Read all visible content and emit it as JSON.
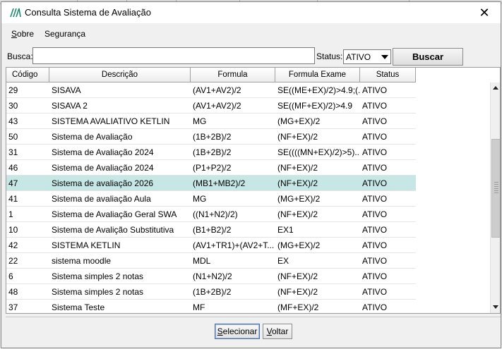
{
  "window": {
    "title": "Consulta Sistema de Avaliação"
  },
  "menu": [
    {
      "label_u": "S",
      "label_rest": "obre"
    },
    {
      "label_u": "",
      "label_rest": "Segurança"
    }
  ],
  "search": {
    "label": "Busca:",
    "value": "",
    "placeholder": ""
  },
  "status_filter": {
    "label": "Status:",
    "selected": "ATIVO"
  },
  "buscar_button": "Buscar",
  "table": {
    "columns": [
      "Código",
      "Descrição",
      "Formula",
      "Formula Exame",
      "Status"
    ],
    "selected_index": 6,
    "rows": [
      [
        "29",
        "SISAVA",
        "(AV1+AV2)/2",
        "SE((ME+EX)/2)>4.9;(...",
        "ATIVO"
      ],
      [
        "30",
        "SISAVA 2",
        "(AV1+AV2)/2",
        "SE((MF+EX)/2)>4.9",
        "ATIVO"
      ],
      [
        "43",
        "SISTEMA AVALIATIVO KETLIN",
        "MG",
        "(MG+EX)/2",
        "ATIVO"
      ],
      [
        "50",
        "Sistema de Avaliação",
        "(1B+2B)/2",
        "(NF+EX)/2",
        "ATIVO"
      ],
      [
        "31",
        "Sistema de Avaliação 2024",
        "(1B+2B)/2",
        "SE((((MN+EX)/2)>5)...",
        "ATIVO"
      ],
      [
        "46",
        "Sistema de Avaliação 2024",
        "(P1+P2)/2",
        "(NF+EX)/2",
        "ATIVO"
      ],
      [
        "47",
        "Sistema de avaliação 2026",
        "(MB1+MB2)/2",
        "(NF+EX)/2",
        "ATIVO"
      ],
      [
        "41",
        "Sistema de avaliação Aula",
        "MG",
        "(MG+EX)/2",
        "ATIVO"
      ],
      [
        "1",
        "Sistema de Avaliação Geral SWA",
        "((N1+N2)/2)",
        "(NF+EX)/2",
        "ATIVO"
      ],
      [
        "10",
        "Sistema de Avalição Substitutiva",
        "(B1+B2)/2",
        "EX1",
        "ATIVO"
      ],
      [
        "42",
        "SISTEMA KETLIN",
        "(AV1+TR1)+(AV2+T...",
        "(MG+EX)/2",
        "ATIVO"
      ],
      [
        "22",
        "sistema moodle",
        "MDL",
        "EX",
        "ATIVO"
      ],
      [
        "6",
        "Sistema simples 2 notas",
        "(N1+N2)/2",
        "(NF+EX)/2",
        "ATIVO"
      ],
      [
        "48",
        "Sistema simples 2 notas",
        "(1B+2B)/2",
        "(NF+EX)/2",
        "ATIVO"
      ],
      [
        "37",
        "Sistema Teste",
        "MF",
        "(MF+EX)/2",
        "ATIVO"
      ]
    ]
  },
  "footer": {
    "selecionar_u": "S",
    "selecionar_rest": "elecionar",
    "voltar_u": "V",
    "voltar_rest": "oltar"
  },
  "colors": {
    "selected_row": "#c6e7e6",
    "icon_green": "#1f8a70"
  }
}
